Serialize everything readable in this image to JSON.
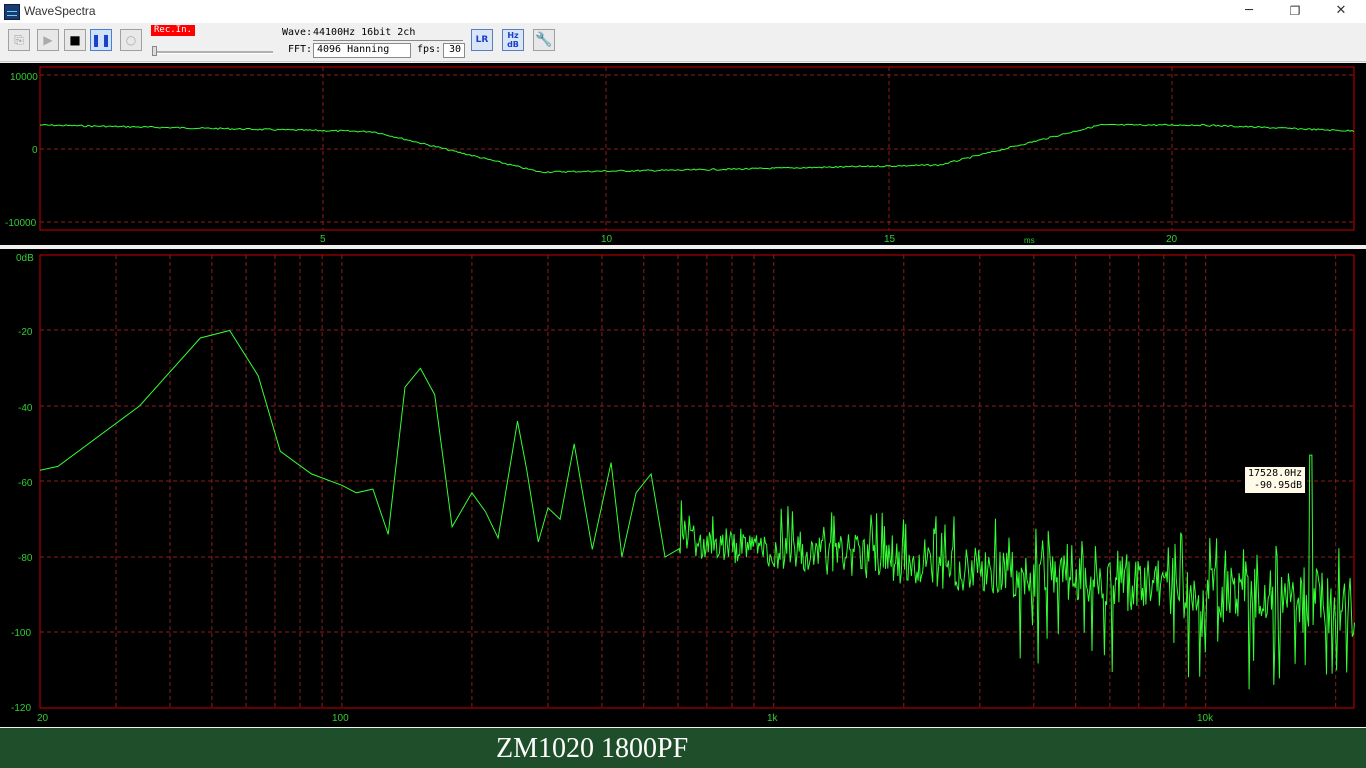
{
  "window": {
    "title": "WaveSpectra",
    "minimize": "─",
    "restore": "❐",
    "close": "✕"
  },
  "toolbar": {
    "rec_label": "Rec.In.",
    "wave_label": "Wave:",
    "wave_value": "44100Hz 16bit 2ch",
    "fft_label": "FFT:",
    "fft_value": "4096 Hanning",
    "fps_label": "fps:",
    "fps_value": "30",
    "lr_label": "LR",
    "hz_label": "Hz",
    "db_label": "dB"
  },
  "wave_panel": {
    "y_ticks": [
      "10000",
      "0",
      "-10000"
    ],
    "x_ticks": [
      "5",
      "10",
      "15",
      "20"
    ],
    "x_unit": "ms"
  },
  "spectrum_panel": {
    "y_ticks": [
      "0dB",
      "-20",
      "-40",
      "-60",
      "-80",
      "-100",
      "-120"
    ],
    "x_ticks": [
      "20",
      "100",
      "1k",
      "10k"
    ],
    "tooltip_freq": "17528.0Hz",
    "tooltip_db": "-90.95dB"
  },
  "colors": {
    "trace": "#33ff33",
    "frame": "#cc0000",
    "grid": "#8a1e1e",
    "label": "#33cc33"
  },
  "footer": {
    "caption": "ZM1020 1800PF"
  }
}
